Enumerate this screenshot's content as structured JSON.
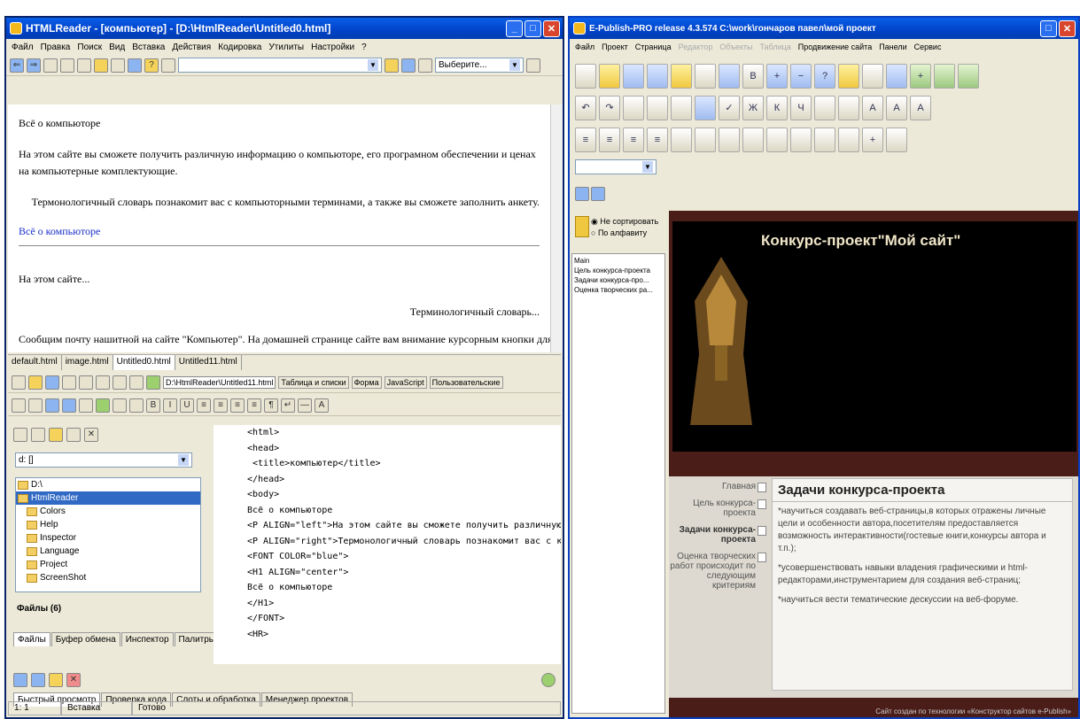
{
  "left": {
    "title": "HTMLReader - [компьютер] - [D:\\HtmlReader\\Untitled0.html]",
    "menu": [
      "Файл",
      "Правка",
      "Поиск",
      "Вид",
      "Вставка",
      "Действия",
      "Кодировка",
      "Утилиты",
      "Настройки",
      "?"
    ],
    "select_value": "Выберите...",
    "preview": {
      "l1": "Всё о компьюторе",
      "l2": "На этом сайте вы сможете получить различную информацию о компьюторе, его програмном обеспечении и ценах на компьютерные комплектующие.",
      "l3": "Термонологичный словарь познакомит вас с компьюторными терминами, а также вы сможете заполнить анкету.",
      "l4": "Всё о компьюторе",
      "l5": "На этом сайте...",
      "l6": "Терминологичный словарь...",
      "l7": "Сообщим почту нашитной на сайте \"Компьютер\". На домашней странице сайте вам внимание курсорным кнопки для"
    },
    "doctabs": [
      "default.html",
      "image.html",
      "Untitled0.html",
      "Untitled11.html"
    ],
    "path": "D:\\HtmlReader\\Untitled11.html",
    "tabs2": [
      "Таблица и списки",
      "Форма",
      "JavaScript",
      "Пользовательские"
    ],
    "drive": "d: []",
    "files": [
      "D:\\",
      "HtmlReader",
      "Colors",
      "Help",
      "Inspector",
      "Language",
      "Project",
      "ScreenShot"
    ],
    "files_label": "Файлы (6)",
    "panel_tabs": [
      "Файлы",
      "Буфер обмена",
      "Инспектор",
      "Палитры"
    ],
    "code": [
      "<html>",
      "<head>",
      " <title>компьютер</title>",
      "</head>",
      "<body>",
      "Всё о компьюторе",
      "<P ALIGN=\"left\">На этом сайте вы сможете получить различную",
      "<P ALIGN=\"right\">Термонологичный словарь познакомит вас с к",
      "<FONT COLOR=\"blue\">",
      "<H1 ALIGN=\"center\">",
      "Всё о компьюторе",
      "</H1>",
      "</FONT>",
      "<HR>"
    ],
    "bottom_tabs": [
      "Быстрый просмотр",
      "Проверка кода",
      "Слоты и обработка",
      "Менеджер проектов"
    ],
    "status": [
      "1: 1",
      "Вставка",
      "Готово"
    ]
  },
  "right": {
    "title": "E-Publish-PRO release 4.3.574      C:\\work\\гончаров павел\\мой проект",
    "menu": [
      "Файл",
      "Проект",
      "Страница",
      "Редактор",
      "Объекты",
      "Таблица",
      "Продвижение сайта",
      "Панели",
      "Сервис"
    ],
    "sort": [
      "Не сортировать",
      "По алфавиту"
    ],
    "pages": [
      "Main",
      "Цель конкурса-проекта",
      "Задачи конкурса-про...",
      "Оценка творческих ра..."
    ],
    "site_title": "Конкурс-проект\"Мой сайт\"",
    "nav": [
      "Главная",
      "Цель конкурса-проекта",
      "Задачи конкурса-проекта",
      "Оценка творческих работ происходит по следующим критериям"
    ],
    "heading": "Задачи конкурса-проекта",
    "p1": "*научиться создавать веб-страницы,в которых отражены личные цели и особенности автора,посетителям предоставляется возможность интерактивности(гостевые книги,конкурсы автора и т.п.);",
    "p2": "*усовершенствовать навыки владения графическими и html-редакторами,инструментарием для создания веб-страниц;",
    "p3": "*научиться вести тематические дескуссии на веб-форуме.",
    "footer": "Сайт создан по технологии «Конструктор сайтов e-Publish»"
  }
}
